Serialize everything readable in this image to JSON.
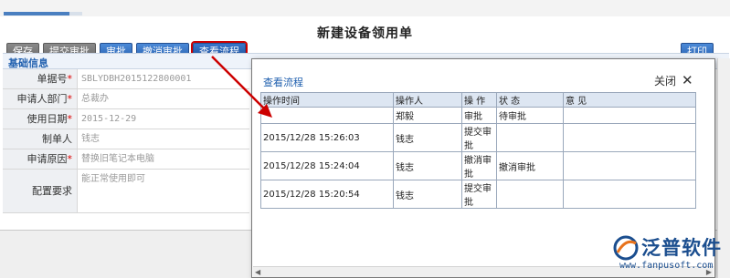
{
  "form": {
    "title": "新建设备领用单",
    "toolbar": {
      "save": "保存",
      "submit_approval": "提交审批",
      "approve": "审批",
      "revoke_approval": "撤消审批",
      "view_flow": "查看流程",
      "print": "打印"
    },
    "section_title": "基础信息",
    "fields": [
      {
        "label": "单据号",
        "required": true,
        "value": "SBLYDBH2015122800001"
      },
      {
        "label": "申请人部门",
        "required": true,
        "value": "总裁办"
      },
      {
        "label": "使用日期",
        "required": true,
        "value": "2015-12-29"
      },
      {
        "label": "制单人",
        "required": false,
        "value": "钱志"
      },
      {
        "label": "申请原因",
        "required": true,
        "value": "替换旧笔记本电脑"
      },
      {
        "label": "配置要求",
        "required": false,
        "value": "能正常使用即可"
      }
    ],
    "required_mark": "*"
  },
  "modal": {
    "title": "查看流程",
    "close_label": "关闭",
    "columns": [
      "操作时间",
      "操作人",
      "操 作",
      "状 态",
      "意 见"
    ],
    "rows": [
      {
        "time": "",
        "operator": "郑毅",
        "action": "审批",
        "status": "待审批",
        "opinion": ""
      },
      {
        "time": "2015/12/28 15:26:03",
        "operator": "钱志",
        "action": "提交审批",
        "status": "",
        "opinion": ""
      },
      {
        "time": "2015/12/28 15:24:04",
        "operator": "钱志",
        "action": "撤消审批",
        "status": "撤消审批",
        "opinion": ""
      },
      {
        "time": "2015/12/28 15:20:54",
        "operator": "钱志",
        "action": "提交审批",
        "status": "",
        "opinion": ""
      }
    ]
  },
  "logo": {
    "name": "泛普软件",
    "url": "www.fanpusoft.com"
  },
  "colors": {
    "accent_blue": "#1f5fae",
    "highlight_red": "#cc0000",
    "logo_orange": "#e8731c"
  },
  "icons": {
    "close": "close-icon",
    "arrow": "annotation-arrow"
  }
}
